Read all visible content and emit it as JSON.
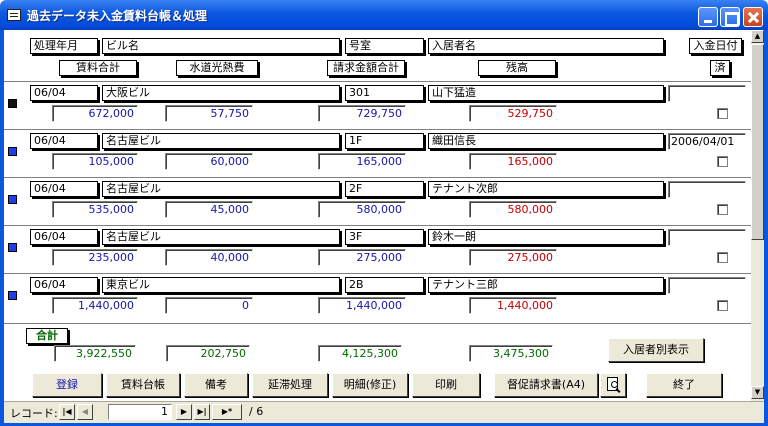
{
  "window": {
    "title": "過去データ未入金賃料台帳＆処理"
  },
  "headers": {
    "month": "処理年月",
    "building": "ビル名",
    "room": "号室",
    "tenant": "入居者名",
    "pay_date": "入金日付",
    "rent_total": "賃料合計",
    "utility": "水道光熱費",
    "billed_total": "請求金額合計",
    "balance": "残高",
    "done": "済"
  },
  "records": [
    {
      "month": "06/04",
      "building": "大阪ビル",
      "room": "301",
      "tenant": "山下猛造",
      "rent": "672,000",
      "utility": "57,750",
      "billed": "729,750",
      "balance": "529,750",
      "pay_date": "",
      "current": true
    },
    {
      "month": "06/04",
      "building": "名古屋ビル",
      "room": "1F",
      "tenant": "織田信長",
      "rent": "105,000",
      "utility": "60,000",
      "billed": "165,000",
      "balance": "165,000",
      "pay_date": "2006/04/01",
      "current": false
    },
    {
      "month": "06/04",
      "building": "名古屋ビル",
      "room": "2F",
      "tenant": "テナント次郎",
      "rent": "535,000",
      "utility": "45,000",
      "billed": "580,000",
      "balance": "580,000",
      "pay_date": "",
      "current": false
    },
    {
      "month": "06/04",
      "building": "名古屋ビル",
      "room": "3F",
      "tenant": "鈴木一朗",
      "rent": "235,000",
      "utility": "40,000",
      "billed": "275,000",
      "balance": "275,000",
      "pay_date": "",
      "current": false
    },
    {
      "month": "06/04",
      "building": "東京ビル",
      "room": "2B",
      "tenant": "テナント三郎",
      "rent": "1,440,000",
      "utility": "0",
      "billed": "1,440,000",
      "balance": "1,440,000",
      "pay_date": "",
      "current": false
    }
  ],
  "totals": {
    "label": "合計",
    "rent": "3,922,550",
    "utility": "202,750",
    "billed": "4,125,300",
    "balance": "3,475,300"
  },
  "buttons": {
    "by_tenant": "入居者別表示",
    "register": "登録",
    "rent_ledger": "賃料台帳",
    "remarks": "備考",
    "late": "延滞処理",
    "detail": "明細(修正)",
    "print": "印刷",
    "reminder": "督促請求書(A4)",
    "exit": "終了"
  },
  "nav": {
    "label": "レコード:",
    "current": "1",
    "total": "/ 6"
  },
  "colors": {
    "amount_blue": "#1515a8",
    "balance_red": "#c20000",
    "totals_green": "#006a00",
    "titlebar": "#0a58df"
  }
}
